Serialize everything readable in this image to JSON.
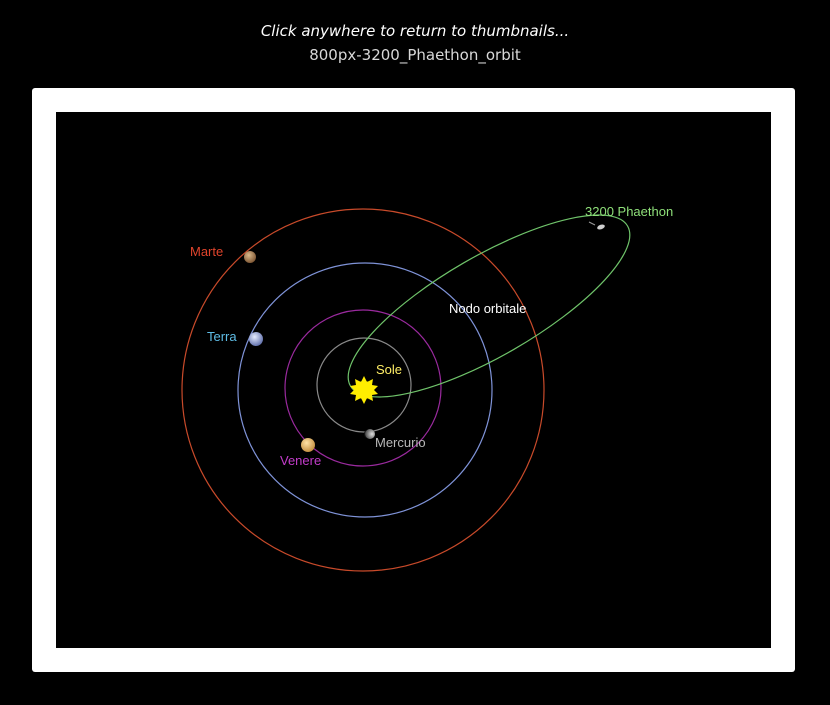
{
  "caption": {
    "hint": "Click anywhere to return to thumbnails...",
    "title": "800px-3200_Phaethon_orbit"
  },
  "figure": {
    "labels": {
      "mars": "Marte",
      "earth": "Terra",
      "venus": "Venere",
      "mercury": "Mercurio",
      "sun": "Sole",
      "node": "Nodo orbitale",
      "phaethon": "3200  Phaethon"
    },
    "colors": {
      "mars_orbit": "#c84a2a",
      "earth_orbit": "#7f93d8",
      "venus_orbit": "#9a2a9e",
      "mercury_orbit": "#8a8a8a",
      "phaethon_orbit": "#6fc36a",
      "sun": "#ffee00",
      "mars_label": "#e0442c",
      "earth_label": "#5fbde6",
      "venus_label": "#c23cc9",
      "mercury_label": "#b8b8b8",
      "sun_label": "#ffee66",
      "node_label": "#ffffff",
      "phaethon_label": "#8fe07a"
    }
  }
}
